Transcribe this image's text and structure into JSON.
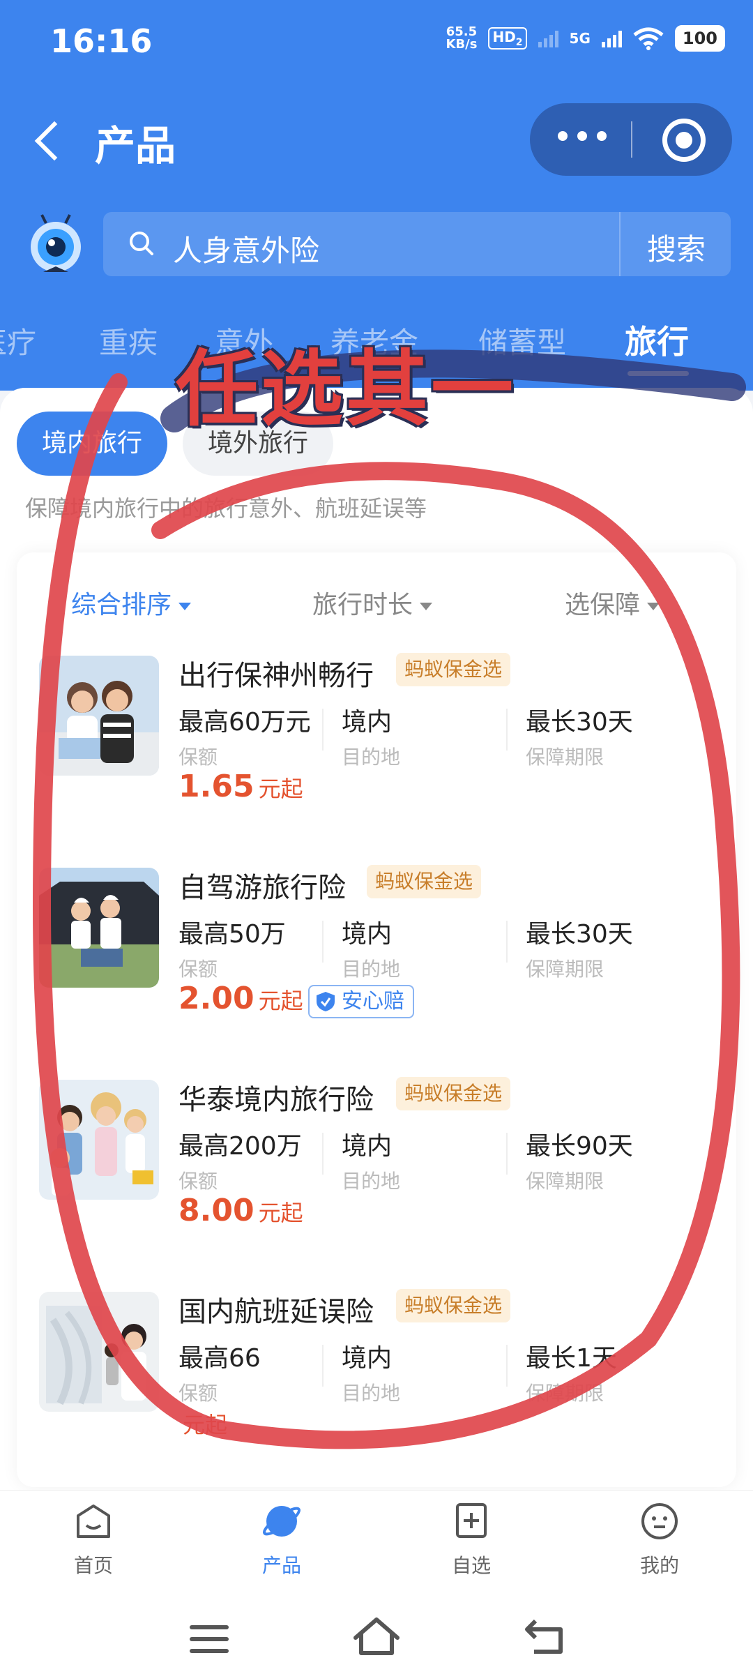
{
  "status_bar": {
    "time": "16:16",
    "net_speed_value": "65.5",
    "net_speed_unit": "KB/s",
    "hd": "HD",
    "hd_sub": "2",
    "network": "5G",
    "battery": "100"
  },
  "nav": {
    "title": "产品"
  },
  "search": {
    "value": "人身意外险",
    "button": "搜索"
  },
  "categories": [
    {
      "label": "医疗"
    },
    {
      "label": "重疾"
    },
    {
      "label": "意外"
    },
    {
      "label": "养老金"
    },
    {
      "label": "储蓄型"
    },
    {
      "label": "旅行"
    }
  ],
  "sub_tabs": [
    {
      "label": "境内旅行"
    },
    {
      "label": "境外旅行"
    }
  ],
  "description": "保障境内旅行中的旅行意外、航班延误等",
  "filters": [
    {
      "label": "综合排序"
    },
    {
      "label": "旅行时长"
    },
    {
      "label": "选保障"
    }
  ],
  "annotation": "任选其一",
  "products": [
    {
      "name": "出行保神州畅行",
      "badge": "蚂蚁保金选",
      "specs": [
        {
          "value": "最高60万元",
          "label": "保额"
        },
        {
          "value": "境内",
          "label": "目的地"
        },
        {
          "value": "最长30天",
          "label": "保障期限"
        }
      ],
      "price": "1.65",
      "price_unit": "元起"
    },
    {
      "name": "自驾游旅行险",
      "badge": "蚂蚁保金选",
      "specs": [
        {
          "value": "最高50万",
          "label": "保额"
        },
        {
          "value": "境内",
          "label": "目的地"
        },
        {
          "value": "最长30天",
          "label": "保障期限"
        }
      ],
      "price": "2.00",
      "price_unit": "元起",
      "tag": "安心赔"
    },
    {
      "name": "华泰境内旅行险",
      "badge": "蚂蚁保金选",
      "specs": [
        {
          "value": "最高200万",
          "label": "保额"
        },
        {
          "value": "境内",
          "label": "目的地"
        },
        {
          "value": "最长90天",
          "label": "保障期限"
        }
      ],
      "price": "8.00",
      "price_unit": "元起"
    },
    {
      "name": "国内航班延误险",
      "badge": "蚂蚁保金选",
      "specs": [
        {
          "value": "最高66",
          "label": "保额"
        },
        {
          "value": "境内",
          "label": "目的地"
        },
        {
          "value": "最长1天",
          "label": "保障期限"
        }
      ],
      "price": "",
      "price_unit": "元起"
    }
  ],
  "tabbar": [
    {
      "label": "首页",
      "icon": "home-icon"
    },
    {
      "label": "产品",
      "icon": "planet-icon"
    },
    {
      "label": "自选",
      "icon": "add-box-icon"
    },
    {
      "label": "我的",
      "icon": "face-icon"
    }
  ],
  "colors": {
    "primary": "#3d84ee",
    "price": "#e4532f",
    "annotation": "#e2403e",
    "badge_bg": "#fdf0dc",
    "badge_text": "#c87e2a"
  }
}
